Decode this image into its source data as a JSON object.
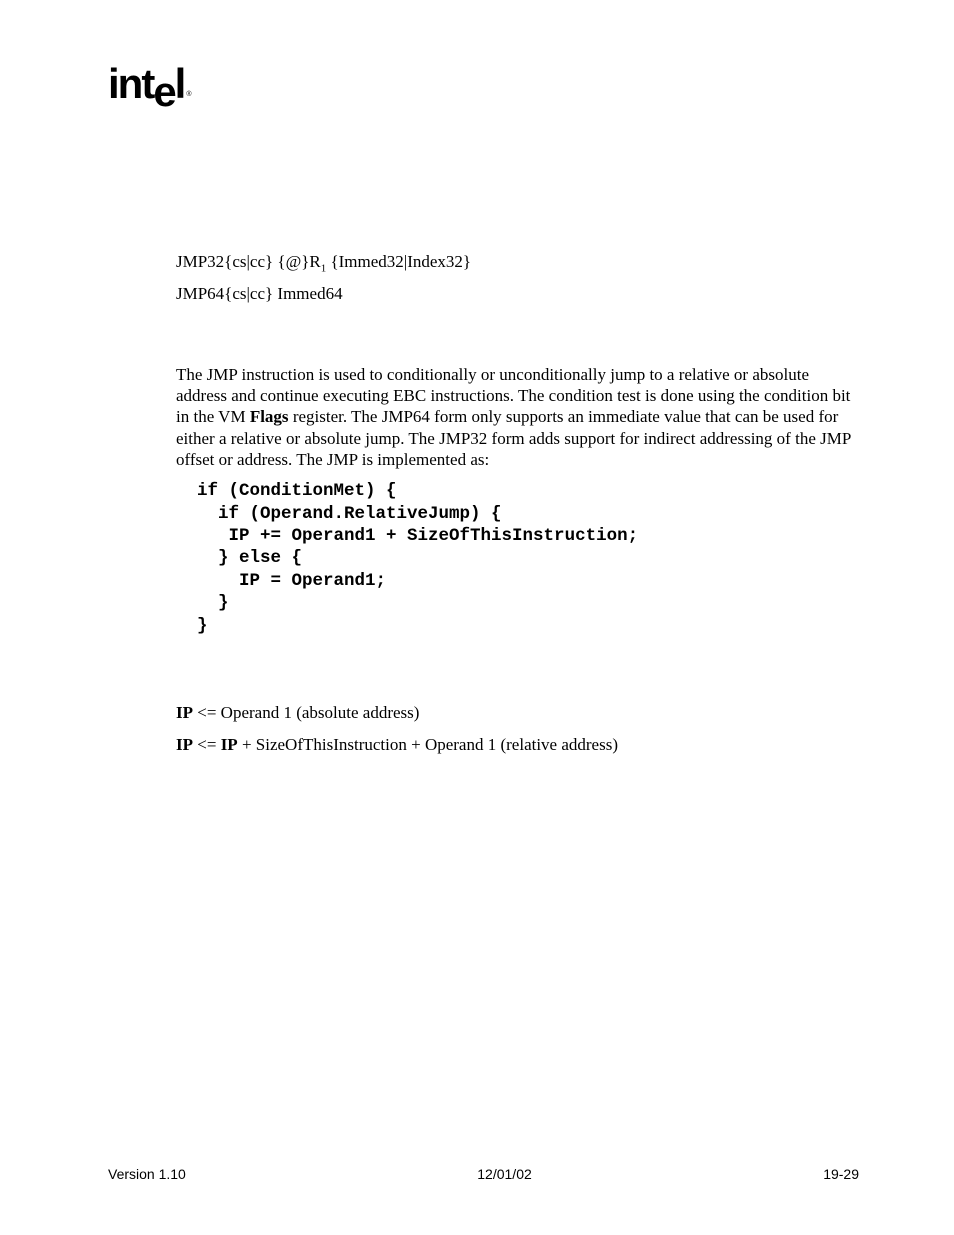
{
  "logo": {
    "text_pre": "int",
    "text_drop": "e",
    "text_post": "l",
    "tm": "®"
  },
  "syntax": {
    "line1_pre": "JMP32{cs|cc} {@}R",
    "line1_sub": "1",
    "line1_post": " {Immed32|Index32}",
    "line2": "JMP64{cs|cc} Immed64"
  },
  "description": {
    "p1a": "The JMP instruction is used to conditionally or unconditionally jump to a relative or absolute address and continue executing EBC instructions. The condition test is done using the condition bit in the VM ",
    "p1b_bold": "Flags",
    "p1c": " register. The JMP64 form only supports an immediate value that can be used for either a relative or absolute jump. The JMP32 form adds support for indirect addressing of the JMP offset or address. The JMP is implemented as:"
  },
  "code": "  if (ConditionMet) {\n    if (Operand.RelativeJump) {\n     IP += Operand1 + SizeOfThisInstruction;\n    } else {\n      IP = Operand1;\n    }\n  }",
  "operation": {
    "line1_b": "IP",
    "line1_rest": " <= Operand 1 (absolute address)",
    "line2_b1": "IP",
    "line2_mid": " <= ",
    "line2_b2": "IP",
    "line2_rest": " + SizeOfThisInstruction + Operand 1 (relative address)"
  },
  "footer": {
    "left": "Version 1.10",
    "center": "12/01/02",
    "right": "19-29"
  }
}
